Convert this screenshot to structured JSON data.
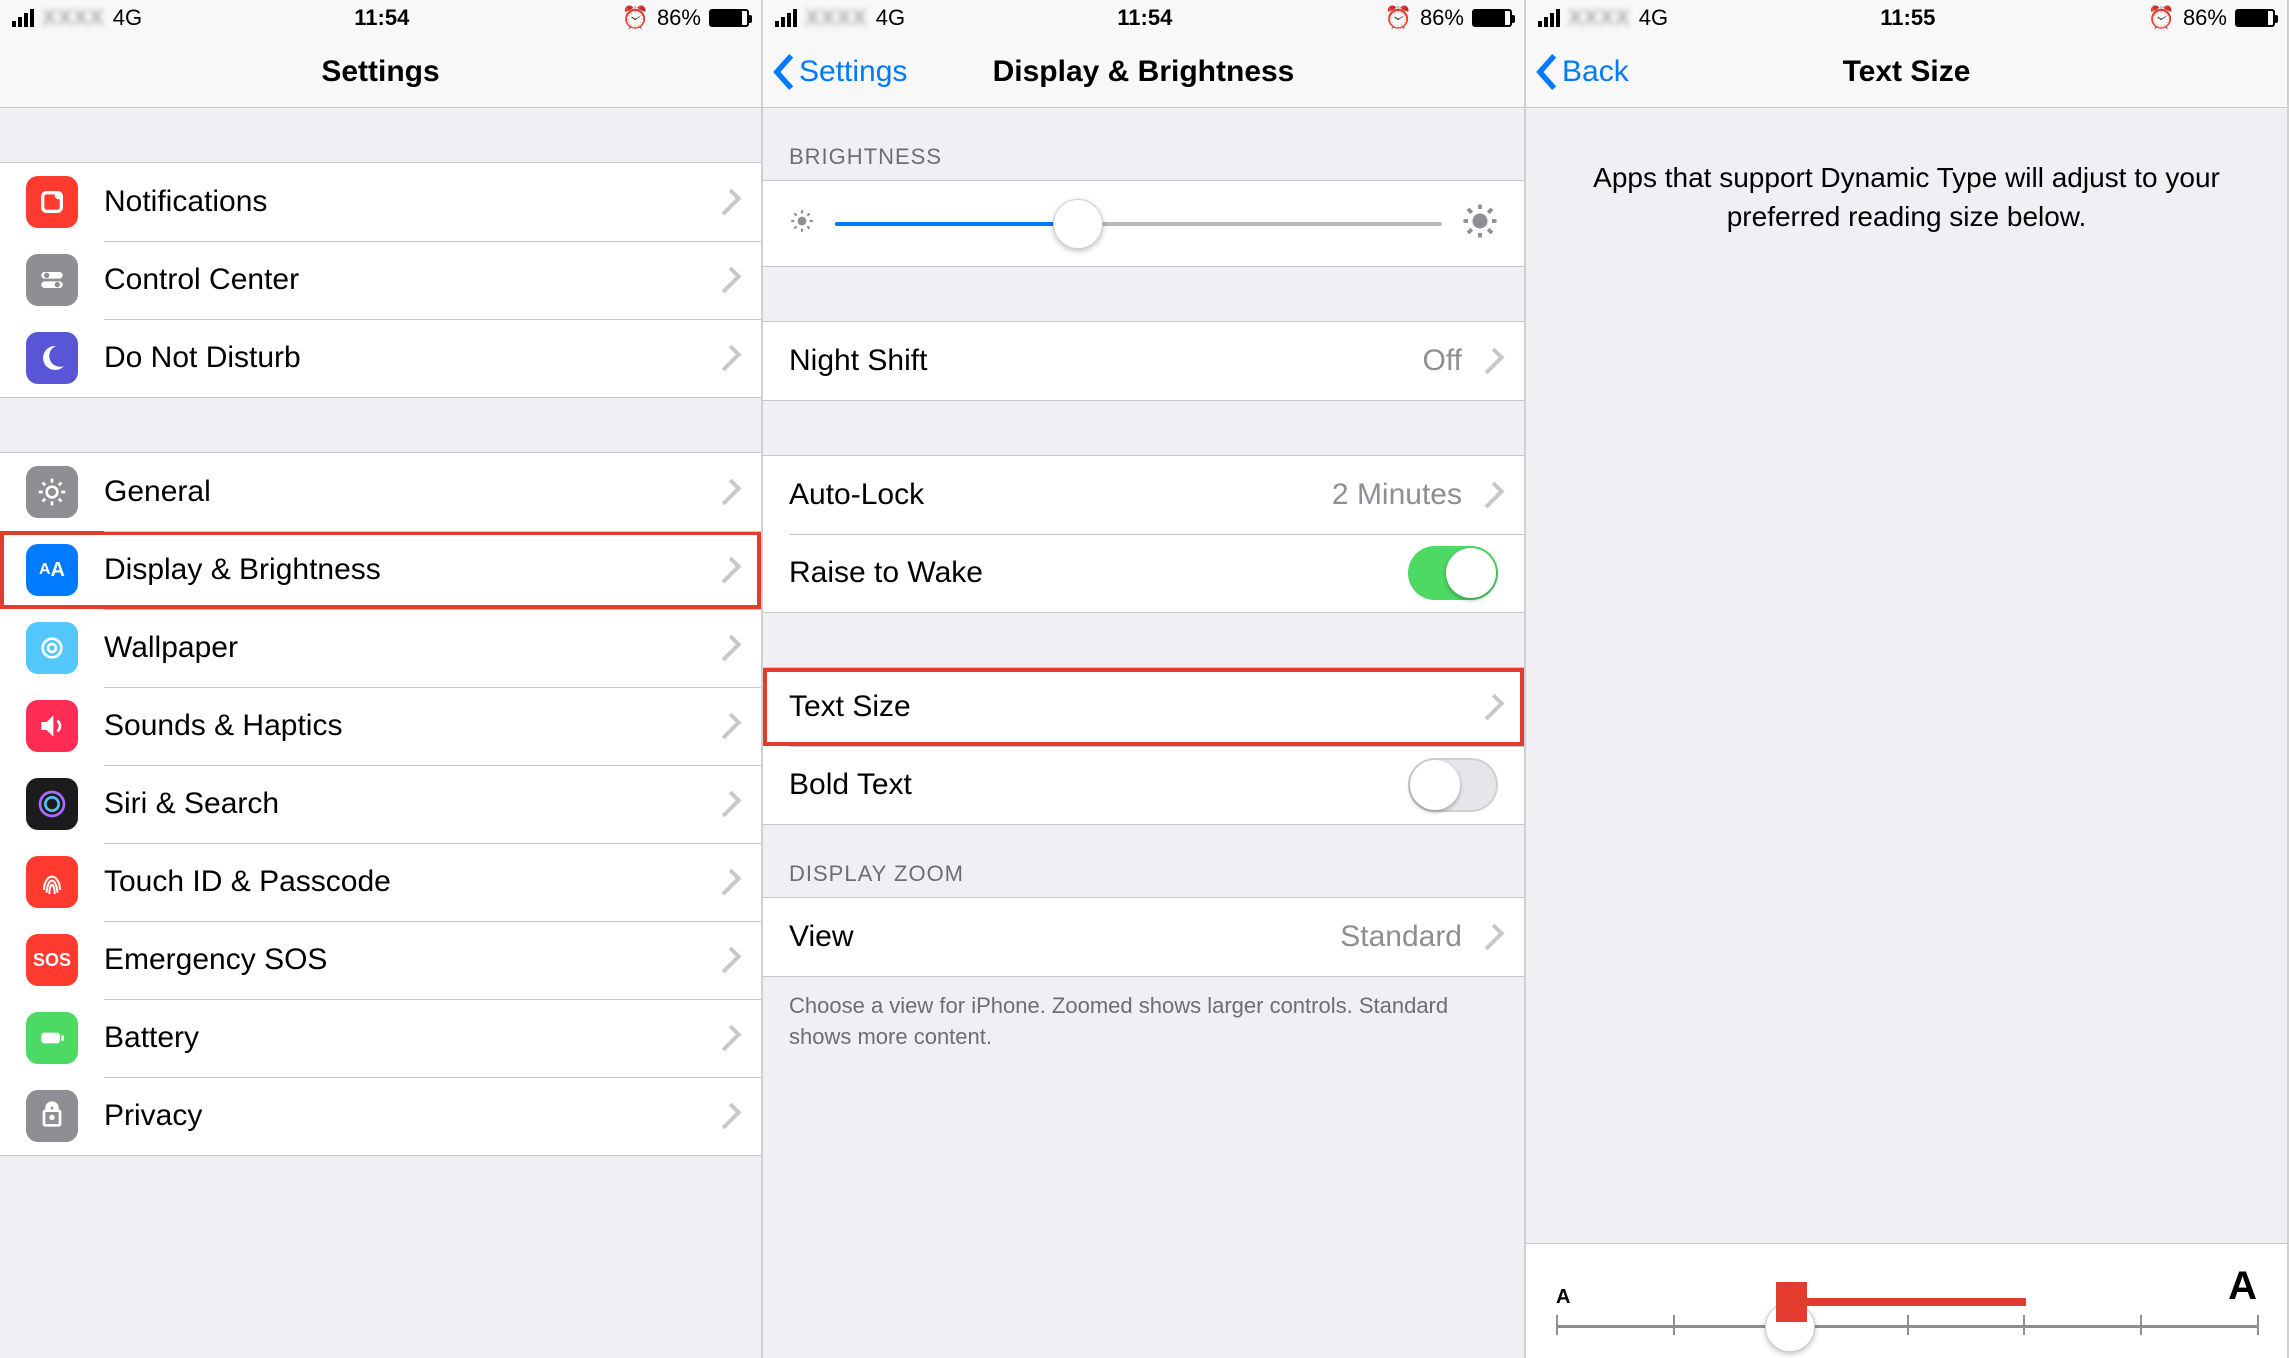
{
  "status": {
    "network": "4G",
    "time1": "11:54",
    "time2": "11:54",
    "time3": "11:55",
    "battery_pct": "86%"
  },
  "screen1": {
    "title": "Settings",
    "items_a": [
      {
        "label": "Notifications",
        "icon": "notifications-icon"
      },
      {
        "label": "Control Center",
        "icon": "control-center-icon"
      },
      {
        "label": "Do Not Disturb",
        "icon": "dnd-icon"
      }
    ],
    "items_b": [
      {
        "label": "General",
        "icon": "general-icon"
      },
      {
        "label": "Display & Brightness",
        "icon": "display-icon",
        "highlight": true
      },
      {
        "label": "Wallpaper",
        "icon": "wallpaper-icon"
      },
      {
        "label": "Sounds & Haptics",
        "icon": "sounds-icon"
      },
      {
        "label": "Siri & Search",
        "icon": "siri-icon"
      },
      {
        "label": "Touch ID & Passcode",
        "icon": "touchid-icon"
      },
      {
        "label": "Emergency SOS",
        "icon": "sos-icon"
      },
      {
        "label": "Battery",
        "icon": "battery-icon"
      },
      {
        "label": "Privacy",
        "icon": "privacy-icon"
      }
    ]
  },
  "screen2": {
    "back": "Settings",
    "title": "Display & Brightness",
    "sections": {
      "brightness": "BRIGHTNESS",
      "display_zoom": "DISPLAY ZOOM"
    },
    "rows": {
      "night_shift": {
        "label": "Night Shift",
        "value": "Off"
      },
      "auto_lock": {
        "label": "Auto-Lock",
        "value": "2 Minutes"
      },
      "raise": {
        "label": "Raise to Wake",
        "on": true
      },
      "text_size": {
        "label": "Text Size",
        "highlight": true
      },
      "bold": {
        "label": "Bold Text",
        "on": false
      },
      "view": {
        "label": "View",
        "value": "Standard"
      }
    },
    "footer": "Choose a view for iPhone. Zoomed shows larger controls. Standard shows more content.",
    "brightness_pct": 40
  },
  "screen3": {
    "back": "Back",
    "title": "Text Size",
    "info": "Apps that support Dynamic Type will adjust to your preferred reading size below.",
    "slider": {
      "steps": 7,
      "value_index": 2,
      "small_label": "A",
      "big_label": "A"
    }
  }
}
